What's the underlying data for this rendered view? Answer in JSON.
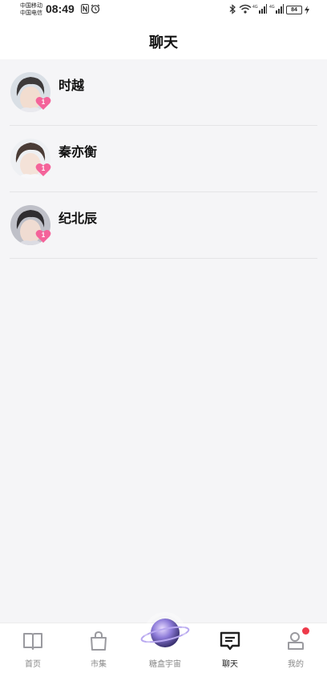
{
  "status_bar": {
    "carrier_1": "中国移动",
    "carrier_2": "中国电信",
    "time": "08:49",
    "battery": "84"
  },
  "header": {
    "title": "聊天"
  },
  "chats": [
    {
      "name": "时越",
      "badge": "1"
    },
    {
      "name": "秦亦衡",
      "badge": "1"
    },
    {
      "name": "纪北辰",
      "badge": "1"
    }
  ],
  "tab_bar": {
    "tabs": [
      {
        "label": "首页",
        "icon": "book-icon"
      },
      {
        "label": "市集",
        "icon": "shopping-bag-icon"
      },
      {
        "label": "糖盒宇宙",
        "icon": "planet-icon"
      },
      {
        "label": "聊天",
        "icon": "chat-icon",
        "active": true
      },
      {
        "label": "我的",
        "icon": "profile-icon"
      }
    ]
  },
  "colors": {
    "heart_badge": "#f4639a",
    "notification_dot": "#ee3a4a",
    "background": "#f5f5f7"
  }
}
